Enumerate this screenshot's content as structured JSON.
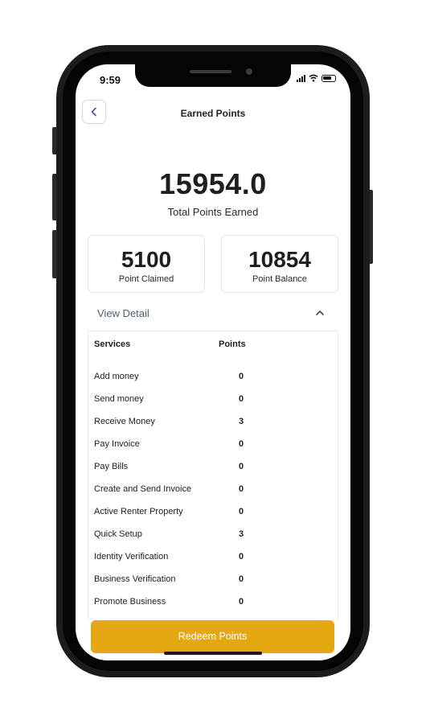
{
  "status_bar": {
    "time": "9:59"
  },
  "header": {
    "title": "Earned Points"
  },
  "summary": {
    "total_value": "15954.0",
    "total_label": "Total Points Earned",
    "claimed_value": "5100",
    "claimed_label": "Point Claimed",
    "balance_value": "10854",
    "balance_label": "Point Balance"
  },
  "detail": {
    "toggle_label": "View Detail",
    "columns": {
      "service": "Services",
      "points": "Points"
    },
    "rows": [
      {
        "service": "Add money",
        "points": "0"
      },
      {
        "service": "Send money",
        "points": "0"
      },
      {
        "service": "Receive Money",
        "points": "3"
      },
      {
        "service": "Pay Invoice",
        "points": "0"
      },
      {
        "service": "Pay Bills",
        "points": "0"
      },
      {
        "service": "Create and Send Invoice",
        "points": "0"
      },
      {
        "service": "Active Renter Property",
        "points": "0"
      },
      {
        "service": "Quick Setup",
        "points": "3"
      },
      {
        "service": "Identity Verification",
        "points": "0"
      },
      {
        "service": "Business Verification",
        "points": "0"
      },
      {
        "service": "Promote Business",
        "points": "0"
      }
    ]
  },
  "actions": {
    "redeem_label": "Redeem Points"
  },
  "colors": {
    "accent": "#e3a812",
    "link": "#4f6270",
    "back_icon": "#6b3fa0"
  },
  "icons": {
    "back": "chevron-left-icon",
    "collapse": "chevron-up-icon",
    "signal": "signal-icon",
    "wifi": "wifi-icon",
    "battery": "battery-icon"
  }
}
